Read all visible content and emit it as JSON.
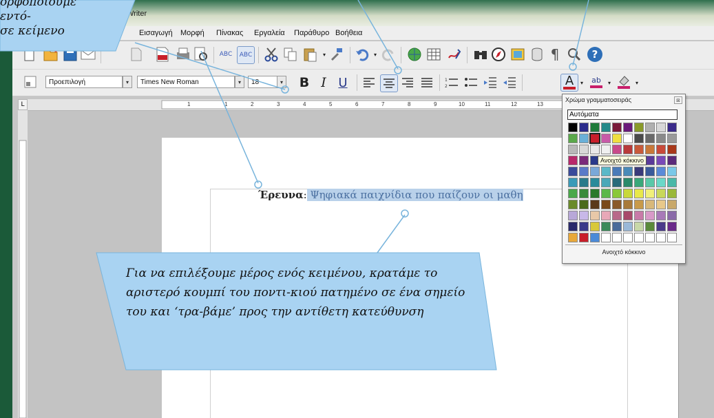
{
  "window": {
    "title": "Writer",
    "menus": [
      "Εισαγωγή",
      "Μορφή",
      "Πίνακας",
      "Εργαλεία",
      "Παράθυρο",
      "Βοήθεια"
    ]
  },
  "toolbar": {
    "style": "Προεπιλογή",
    "font": "Times New Roman",
    "size": "18",
    "bold": "B",
    "italic": "I",
    "underline": "U",
    "font_color": "A",
    "highlight": "ab",
    "spell_check": "ABC"
  },
  "ruler": {
    "ticks": [
      "1",
      "1",
      "2",
      "3",
      "4",
      "5",
      "6",
      "7",
      "8",
      "9",
      "10",
      "11",
      "12",
      "13",
      "14"
    ],
    "corner": "L"
  },
  "document": {
    "bold_word": "Έρευνα",
    "colon": ":",
    "selected_text": " Ψηφιακά παιχνίδια που παίζουν οι μαθη"
  },
  "color_popup": {
    "title": "Χρώμα γραμματοσειράς",
    "automatic": "Αυτόματα",
    "tooltip": "Ανοιχτό κόκκινο",
    "footer": "Ανοιχτό κόκκινο",
    "swatches": [
      "#000000",
      "#2b2b8c",
      "#1f7a3a",
      "#248a8a",
      "#7a1a3a",
      "#6a1a7a",
      "#8a9a2a",
      "#b0b0b0",
      "#d8d8d8",
      "#3b2b8a",
      "#5aa84a",
      "#6ab0d8",
      "#c81e2a",
      "#c85aa8",
      "#f0e040",
      "#ffffff",
      "#4a4a4a",
      "#6a6a6a",
      "#8a8a8a",
      "#9a9a9a",
      "#b8b8b8",
      "#d8d8d8",
      "#e8e8e8",
      "#f0f0f0",
      "#c84a8a",
      "#b83a3a",
      "#c85a3a",
      "#c8783a",
      "#c84a3a",
      "#a8381a",
      "#b8286a",
      "#7a2a7a",
      "#2a3a8a",
      "#3a5aa8",
      "#7a5aa8",
      "#8a3a8a",
      "#3a2a6a",
      "#5a3a9a",
      "#7a4ab8",
      "#5a2a7a",
      "#3a4a9a",
      "#5a7ac8",
      "#7aa8d8",
      "#5ab8c8",
      "#4a7ab8",
      "#4a8ab8",
      "#3a3a7a",
      "#3a5a9a",
      "#5a8ad8",
      "#7ac8e8",
      "#3a9ab8",
      "#2a7a8a",
      "#2a8a9a",
      "#4aa8b8",
      "#2a6a7a",
      "#2a8a6a",
      "#3aa87a",
      "#5ac8a8",
      "#6ad8c8",
      "#4ab8a8",
      "#4aa84a",
      "#3a8a3a",
      "#2a7a2a",
      "#5ab84a",
      "#8ac83a",
      "#c8d83a",
      "#e8e84a",
      "#f0f07a",
      "#c8d85a",
      "#9ab83a",
      "#6a8a2a",
      "#4a6a1a",
      "#5a3a1a",
      "#7a4a1a",
      "#8a5a2a",
      "#a87a3a",
      "#c89a4a",
      "#d8b87a",
      "#e8c88a",
      "#c8a86a",
      "#b8a8d8",
      "#c8b8e8",
      "#e8c8a8",
      "#e8a8b8",
      "#b86a8a",
      "#a84a6a",
      "#c87aa8",
      "#d89ac8",
      "#a87ab8",
      "#8a6aa8",
      "#2a2a6a",
      "#3a3a8a",
      "#d8c83a",
      "#3a8a5a",
      "#4a6a9a",
      "#9ab8d8",
      "#c8d8a8",
      "#5a8a3a",
      "#4a3a8a",
      "#6a2a8a",
      "#e8a83a",
      "#c81e2a",
      "#4a8ad8",
      "#ffffff",
      "#ffffff",
      "#ffffff",
      "#ffffff",
      "#ffffff",
      "#ffffff",
      "#ffffff"
    ],
    "selected_index": 12
  },
  "callouts": {
    "top_text": "ορφοποιούμε εντό-\nσε κείμενο",
    "big_text": "Για να επιλέξουμε μέρος ενός κειμένου, κρατάμε το αριστερό κουμπί του ποντι-κιού πατημένο σε ένα σημείο του και ‘τρα-βάμε’ προς την αντίθετη κατεύθυνση"
  },
  "colors": {
    "callout_fill": "#a9d3f2",
    "callout_stroke": "#78b4dc",
    "selection": "#b9d1ea"
  }
}
